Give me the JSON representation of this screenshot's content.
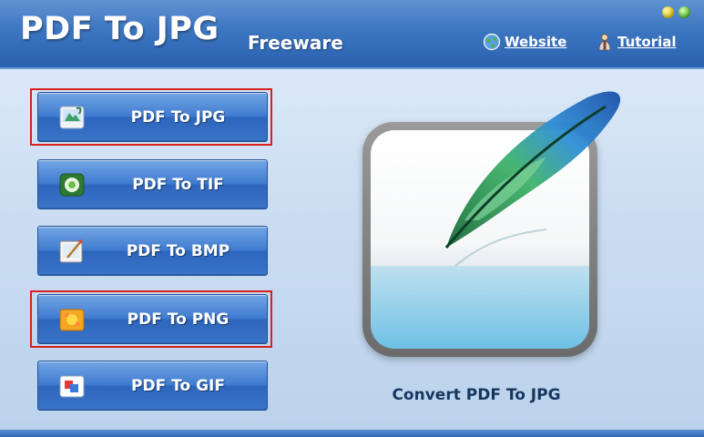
{
  "header": {
    "title": "PDF To JPG",
    "subtitle": "Freeware",
    "links": {
      "website": "Website",
      "tutorial": "Tutorial"
    }
  },
  "window_controls": {
    "minimize_color": "#e0c21a",
    "close_color": "#55b82c"
  },
  "buttons": [
    {
      "label": "PDF To JPG",
      "icon": "jpg-image-icon",
      "highlighted": true
    },
    {
      "label": "PDF To TIF",
      "icon": "tif-image-icon",
      "highlighted": false
    },
    {
      "label": "PDF To BMP",
      "icon": "bmp-paint-icon",
      "highlighted": false
    },
    {
      "label": "PDF To PNG",
      "icon": "png-image-icon",
      "highlighted": true
    },
    {
      "label": "PDF To GIF",
      "icon": "gif-image-icon",
      "highlighted": false
    }
  ],
  "preview": {
    "caption": "Convert PDF To JPG",
    "icon": "feather-icon"
  },
  "colors": {
    "header": "#3c75c0",
    "button": "#3f7bd0",
    "highlight": "#d8201e",
    "caption": "#15375f"
  }
}
